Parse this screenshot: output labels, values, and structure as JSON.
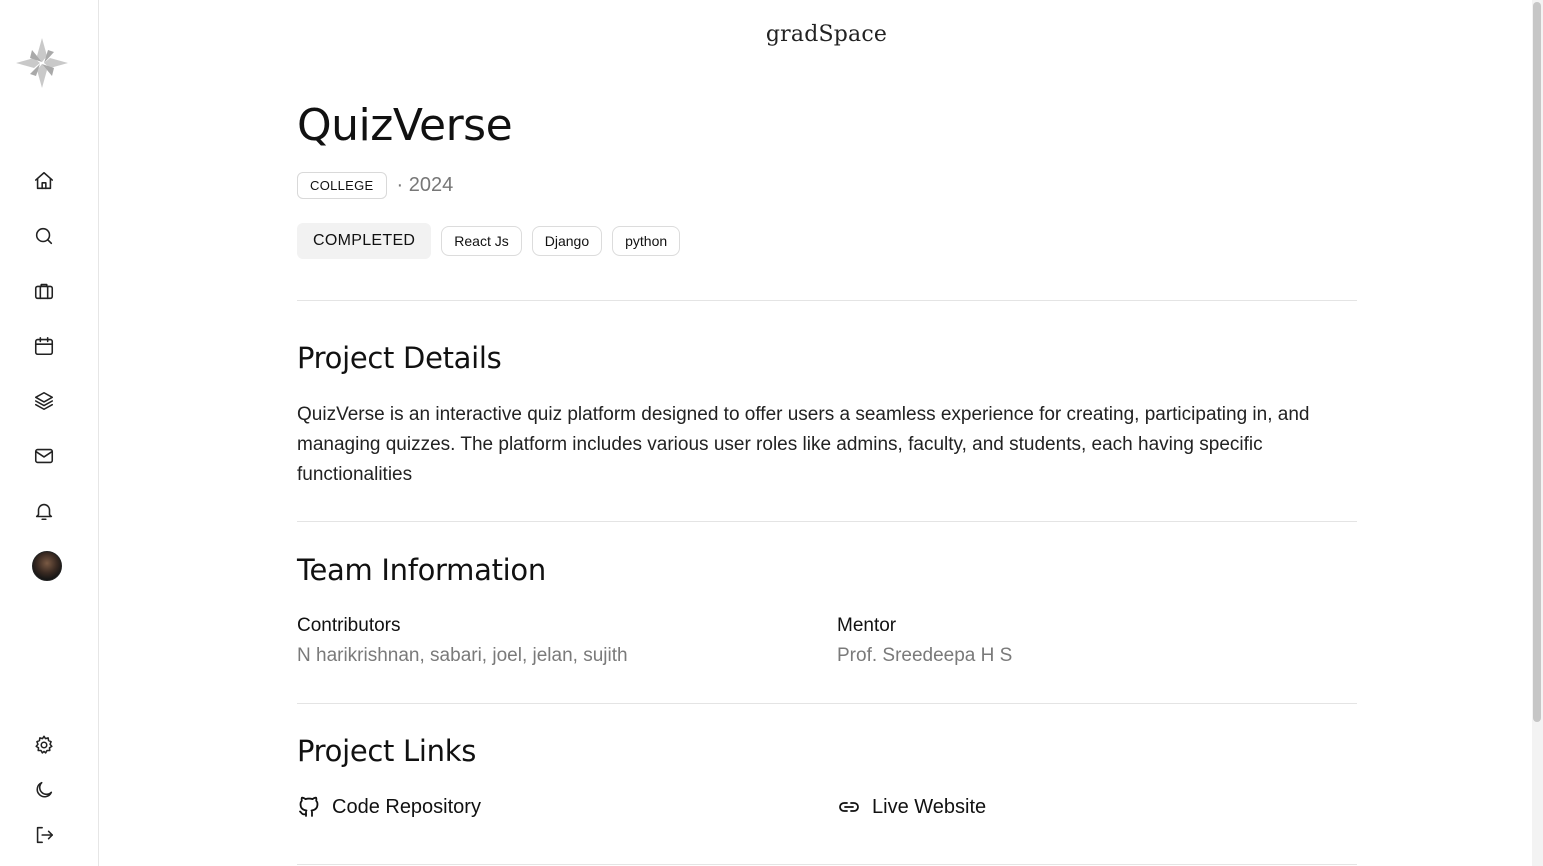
{
  "brand": {
    "name": "gradSpace"
  },
  "sidebar": {
    "items": [
      {
        "name": "home",
        "icon": "home-icon"
      },
      {
        "name": "search",
        "icon": "search-icon"
      },
      {
        "name": "projects",
        "icon": "briefcase-icon"
      },
      {
        "name": "calendar",
        "icon": "calendar-icon"
      },
      {
        "name": "layers",
        "icon": "layers-icon"
      },
      {
        "name": "messages",
        "icon": "mail-icon"
      },
      {
        "name": "notifications",
        "icon": "bell-icon"
      }
    ],
    "bottom": [
      {
        "name": "settings",
        "icon": "gear-icon"
      },
      {
        "name": "theme",
        "icon": "moon-icon"
      },
      {
        "name": "logout",
        "icon": "logout-icon"
      }
    ]
  },
  "project": {
    "title": "QuizVerse",
    "level": "COLLEGE",
    "year": "· 2024",
    "status": "COMPLETED",
    "tags": [
      "React Js",
      "Django",
      "python"
    ]
  },
  "details": {
    "heading": "Project Details",
    "description": "QuizVerse is an interactive quiz platform designed to offer users a seamless experience for creating, participating in, and managing quizzes. The platform includes various user roles like admins, faculty, and students, each having specific functionalities"
  },
  "team": {
    "heading": "Team Information",
    "contributors_label": "Contributors",
    "contributors": "N harikrishnan, sabari, joel, jelan, sujith",
    "mentor_label": "Mentor",
    "mentor": "Prof. Sreedeepa H S"
  },
  "links": {
    "heading": "Project Links",
    "code_repository": "Code Repository",
    "live_website": "Live Website"
  }
}
